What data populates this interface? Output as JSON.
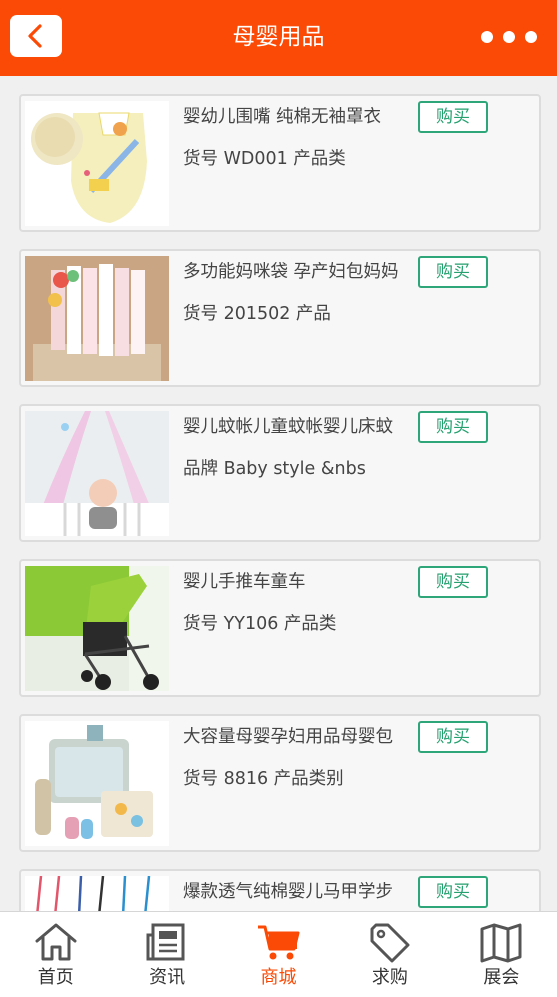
{
  "header": {
    "title": "母婴用品",
    "back_icon": "chevron-left-icon",
    "more_icon": "more-dots-icon",
    "bg_color": "#fb4a05"
  },
  "products": [
    {
      "title": "婴幼儿围嘴 纯棉无袖罩衣",
      "sub": "货号 WD001 产品类",
      "buy_label": "购买"
    },
    {
      "title": "多功能妈咪袋 孕产妇包妈妈",
      "sub": "货号 201502 产品",
      "buy_label": "购买"
    },
    {
      "title": "婴儿蚊帐儿童蚊帐婴儿床蚊",
      "sub": "品牌 Baby style &nbs",
      "buy_label": "购买"
    },
    {
      "title": "婴儿手推车童车",
      "sub": "货号 YY106 产品类",
      "buy_label": "购买"
    },
    {
      "title": "大容量母婴孕妇用品母婴包",
      "sub": "货号 8816 产品类别",
      "buy_label": "购买"
    },
    {
      "title": "爆款透气纯棉婴儿马甲学步",
      "sub": "",
      "buy_label": "购买"
    }
  ],
  "tabbar": {
    "active_color": "#fb4a05",
    "items": [
      {
        "label": "首页",
        "icon": "home-icon",
        "active": false
      },
      {
        "label": "资讯",
        "icon": "news-icon",
        "active": false
      },
      {
        "label": "商城",
        "icon": "cart-icon",
        "active": true
      },
      {
        "label": "求购",
        "icon": "tag-icon",
        "active": false
      },
      {
        "label": "展会",
        "icon": "map-icon",
        "active": false
      }
    ]
  }
}
